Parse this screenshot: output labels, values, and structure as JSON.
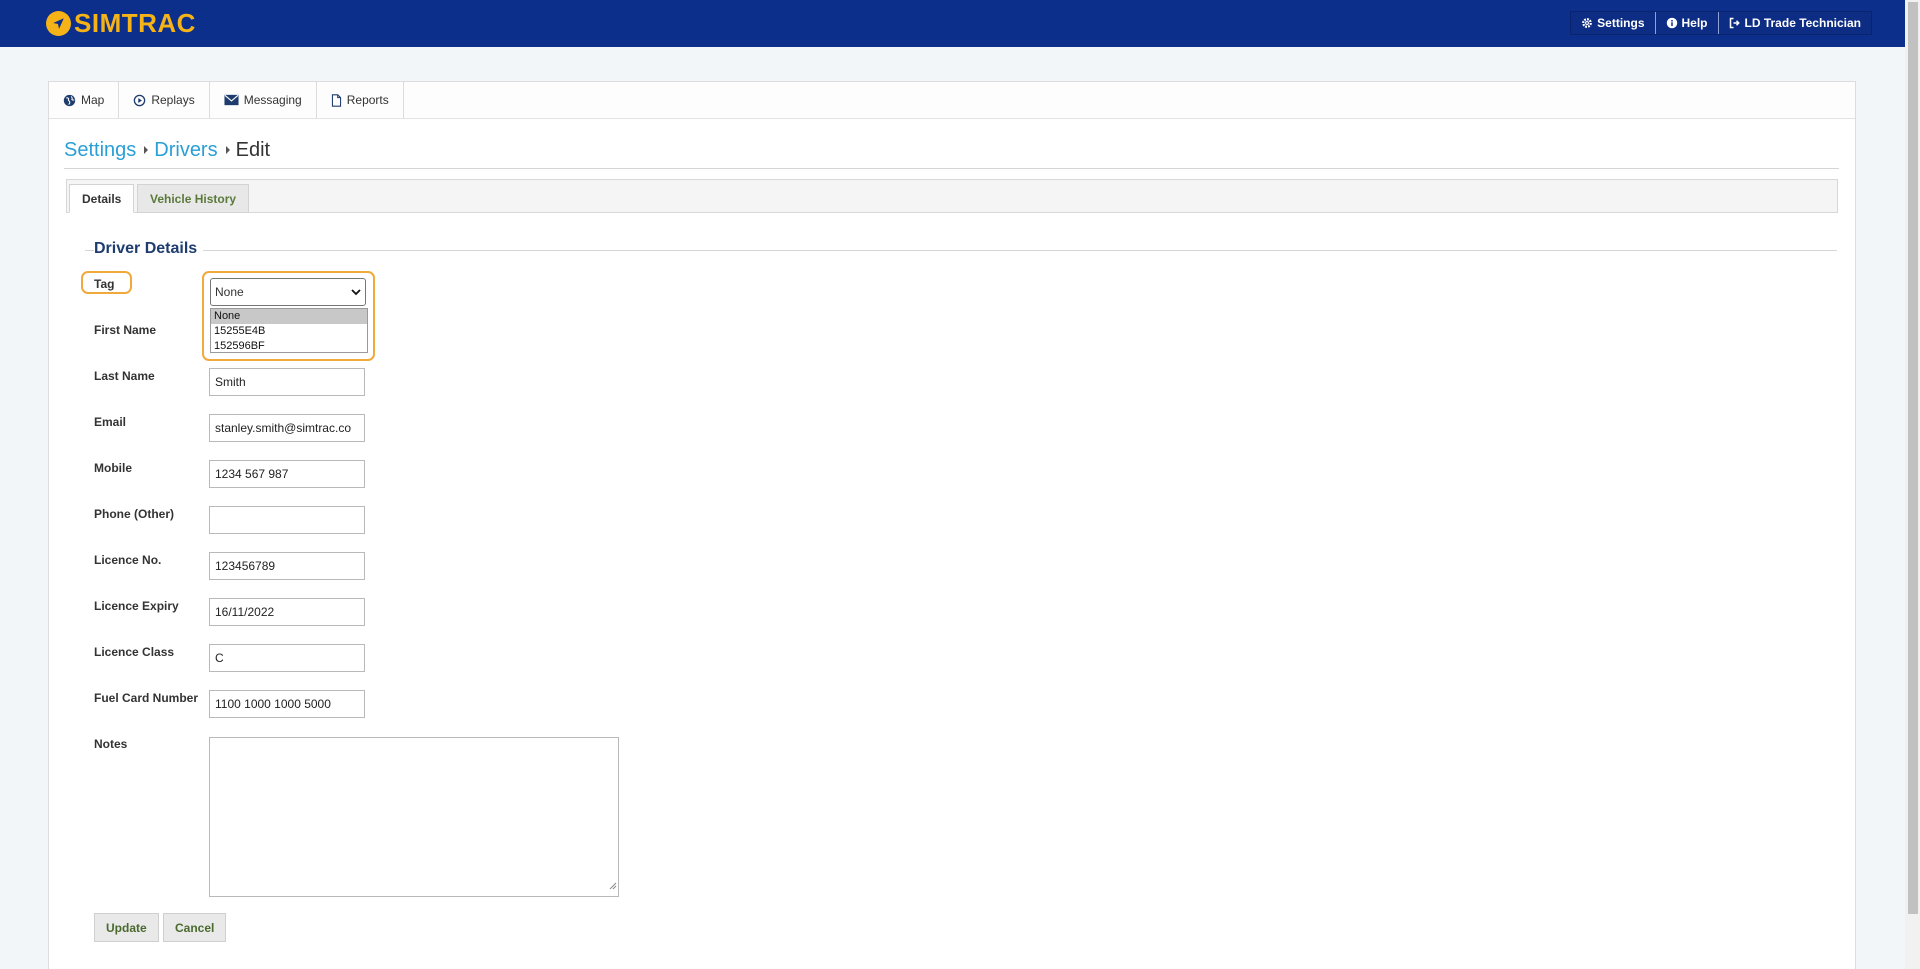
{
  "brand": {
    "logo_text": "SIMTRAC",
    "color": "#f5b317"
  },
  "topnav": {
    "settings_label": "Settings",
    "help_label": "Help",
    "user_label": "LD Trade Technician"
  },
  "main_tabs": [
    {
      "label": "Map",
      "icon": "globe-icon"
    },
    {
      "label": "Replays",
      "icon": "play-circle-icon"
    },
    {
      "label": "Messaging",
      "icon": "envelope-icon"
    },
    {
      "label": "Reports",
      "icon": "file-icon"
    }
  ],
  "breadcrumb": {
    "settings": "Settings",
    "drivers": "Drivers",
    "current": "Edit"
  },
  "subtabs": {
    "details": "Details",
    "vehicle_history": "Vehicle History"
  },
  "form": {
    "section_title": "Driver Details",
    "tag": {
      "label": "Tag",
      "selected": "None",
      "options": [
        "None",
        "15255E4B",
        "152596BF"
      ]
    },
    "first_name_label": "First Name",
    "last_name": {
      "label": "Last Name",
      "value": "Smith"
    },
    "email": {
      "label": "Email",
      "value": "stanley.smith@simtrac.co"
    },
    "mobile": {
      "label": "Mobile",
      "value": "1234 567 987"
    },
    "phone_other": {
      "label": "Phone (Other)",
      "value": ""
    },
    "licence_no": {
      "label": "Licence No.",
      "value": "123456789"
    },
    "licence_expiry": {
      "label": "Licence Expiry",
      "value": "16/11/2022"
    },
    "licence_class": {
      "label": "Licence Class",
      "value": "C"
    },
    "fuel_card": {
      "label": "Fuel Card Number",
      "value": "1100 1000 1000 5000"
    },
    "notes": {
      "label": "Notes",
      "value": ""
    },
    "update_label": "Update",
    "cancel_label": "Cancel"
  },
  "colors": {
    "header_bg": "#0c2f8c",
    "link": "#2a9fd6",
    "highlight": "#f2a93b"
  }
}
